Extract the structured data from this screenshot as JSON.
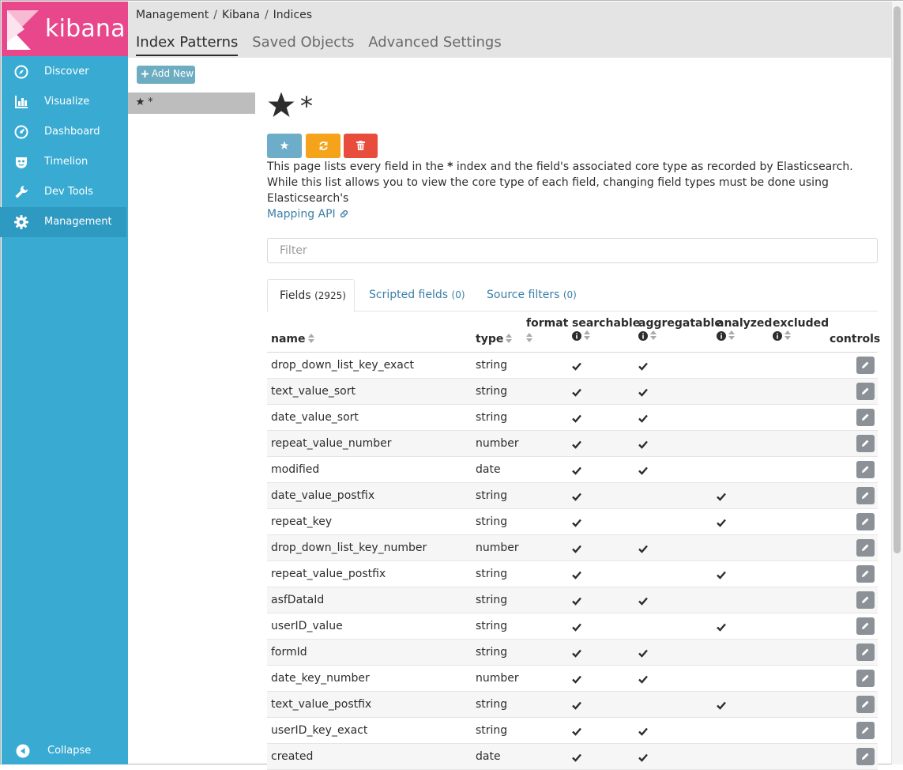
{
  "app": {
    "logo_text": "kibana"
  },
  "nav": {
    "items": [
      {
        "label": "Discover",
        "icon": "compass-icon"
      },
      {
        "label": "Visualize",
        "icon": "bar-chart-icon"
      },
      {
        "label": "Dashboard",
        "icon": "dashboard-gauge-icon"
      },
      {
        "label": "Timelion",
        "icon": "timelion-mask-icon"
      },
      {
        "label": "Dev Tools",
        "icon": "wrench-icon"
      },
      {
        "label": "Management",
        "icon": "gear-icon",
        "active": true
      }
    ],
    "collapse_label": "Collapse"
  },
  "breadcrumb": [
    "Management",
    "Kibana",
    "Indices"
  ],
  "breadcrumb_sep": "/",
  "tabs": [
    {
      "label": "Index Patterns",
      "active": true
    },
    {
      "label": "Saved Objects"
    },
    {
      "label": "Advanced Settings"
    }
  ],
  "patterns": {
    "add_new_label": "Add New",
    "items": [
      {
        "label": "*",
        "default": true
      }
    ]
  },
  "index": {
    "title": "*",
    "description_before": "This page lists every field in the ",
    "description_bold": "*",
    "description_after": " index and the field's associated core type as recorded by Elasticsearch. While this list allows you to view the core type of each field, changing field types must be done using Elasticsearch's ",
    "mapping_link": "Mapping API"
  },
  "actions": {
    "default_color": "#6eadc9",
    "refresh_color": "#f5a31a",
    "delete_color": "#e74c3c"
  },
  "filter": {
    "placeholder": "Filter"
  },
  "subtabs": [
    {
      "label": "Fields",
      "count": "(2925)",
      "active": true
    },
    {
      "label": "Scripted fields",
      "count": "(0)"
    },
    {
      "label": "Source filters",
      "count": "(0)"
    }
  ],
  "table": {
    "headers": {
      "name": "name",
      "type": "type",
      "format": "format",
      "searchable": "searchable",
      "aggregatable": "aggregatable",
      "analyzed": "analyzed",
      "excluded": "excluded",
      "controls": "controls"
    },
    "rows": [
      {
        "name": "drop_down_list_key_exact",
        "type": "string",
        "searchable": true,
        "aggregatable": true,
        "analyzed": false
      },
      {
        "name": "text_value_sort",
        "type": "string",
        "searchable": true,
        "aggregatable": true,
        "analyzed": false
      },
      {
        "name": "date_value_sort",
        "type": "string",
        "searchable": true,
        "aggregatable": true,
        "analyzed": false
      },
      {
        "name": "repeat_value_number",
        "type": "number",
        "searchable": true,
        "aggregatable": true,
        "analyzed": false
      },
      {
        "name": "modified",
        "type": "date",
        "searchable": true,
        "aggregatable": true,
        "analyzed": false
      },
      {
        "name": "date_value_postfix",
        "type": "string",
        "searchable": true,
        "aggregatable": false,
        "analyzed": true
      },
      {
        "name": "repeat_key",
        "type": "string",
        "searchable": true,
        "aggregatable": false,
        "analyzed": true
      },
      {
        "name": "drop_down_list_key_number",
        "type": "number",
        "searchable": true,
        "aggregatable": true,
        "analyzed": false
      },
      {
        "name": "repeat_value_postfix",
        "type": "string",
        "searchable": true,
        "aggregatable": false,
        "analyzed": true
      },
      {
        "name": "asfDataId",
        "type": "string",
        "searchable": true,
        "aggregatable": true,
        "analyzed": false
      },
      {
        "name": "userID_value",
        "type": "string",
        "searchable": true,
        "aggregatable": false,
        "analyzed": true
      },
      {
        "name": "formId",
        "type": "string",
        "searchable": true,
        "aggregatable": true,
        "analyzed": false
      },
      {
        "name": "date_key_number",
        "type": "number",
        "searchable": true,
        "aggregatable": true,
        "analyzed": false
      },
      {
        "name": "text_value_postfix",
        "type": "string",
        "searchable": true,
        "aggregatable": false,
        "analyzed": true
      },
      {
        "name": "userID_key_exact",
        "type": "string",
        "searchable": true,
        "aggregatable": true,
        "analyzed": false
      },
      {
        "name": "created",
        "type": "date",
        "searchable": true,
        "aggregatable": true,
        "analyzed": false
      }
    ]
  }
}
